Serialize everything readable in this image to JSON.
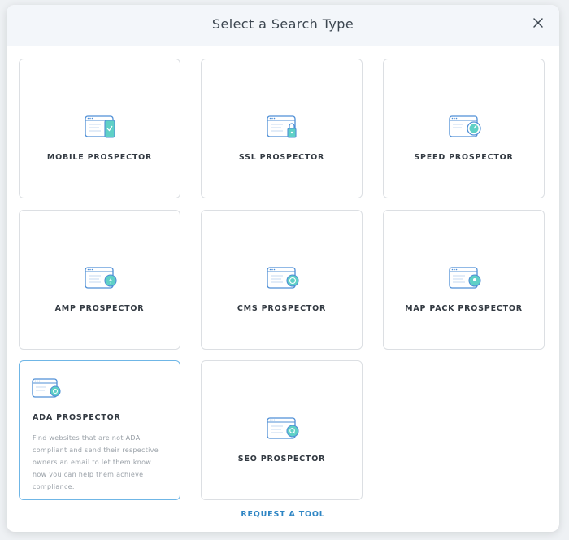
{
  "modal": {
    "title": "Select a Search Type",
    "request_tool_label": "REQUEST A TOOL"
  },
  "cards": [
    {
      "label": "MOBILE PROSPECTOR",
      "icon": "mobile-browser-icon"
    },
    {
      "label": "SSL PROSPECTOR",
      "icon": "ssl-lock-browser-icon"
    },
    {
      "label": "SPEED PROSPECTOR",
      "icon": "speed-gauge-browser-icon"
    },
    {
      "label": "AMP PROSPECTOR",
      "icon": "amp-browser-icon"
    },
    {
      "label": "CMS PROSPECTOR",
      "icon": "cms-browser-icon"
    },
    {
      "label": "MAP PACK PROSPECTOR",
      "icon": "map-pin-browser-icon"
    },
    {
      "label": "ADA PROSPECTOR",
      "icon": "ada-browser-icon",
      "selected": true,
      "description": "Find websites that are not ADA compliant and send their respective owners an email to let them know how you can help them achieve compliance."
    },
    {
      "label": "SEO PROSPECTOR",
      "icon": "seo-browser-icon"
    }
  ],
  "colors": {
    "accent": "#2f86c4",
    "icon_teal": "#5fd0c6",
    "icon_blue": "#4f8fd6",
    "selected_border": "#6fb6e6"
  }
}
